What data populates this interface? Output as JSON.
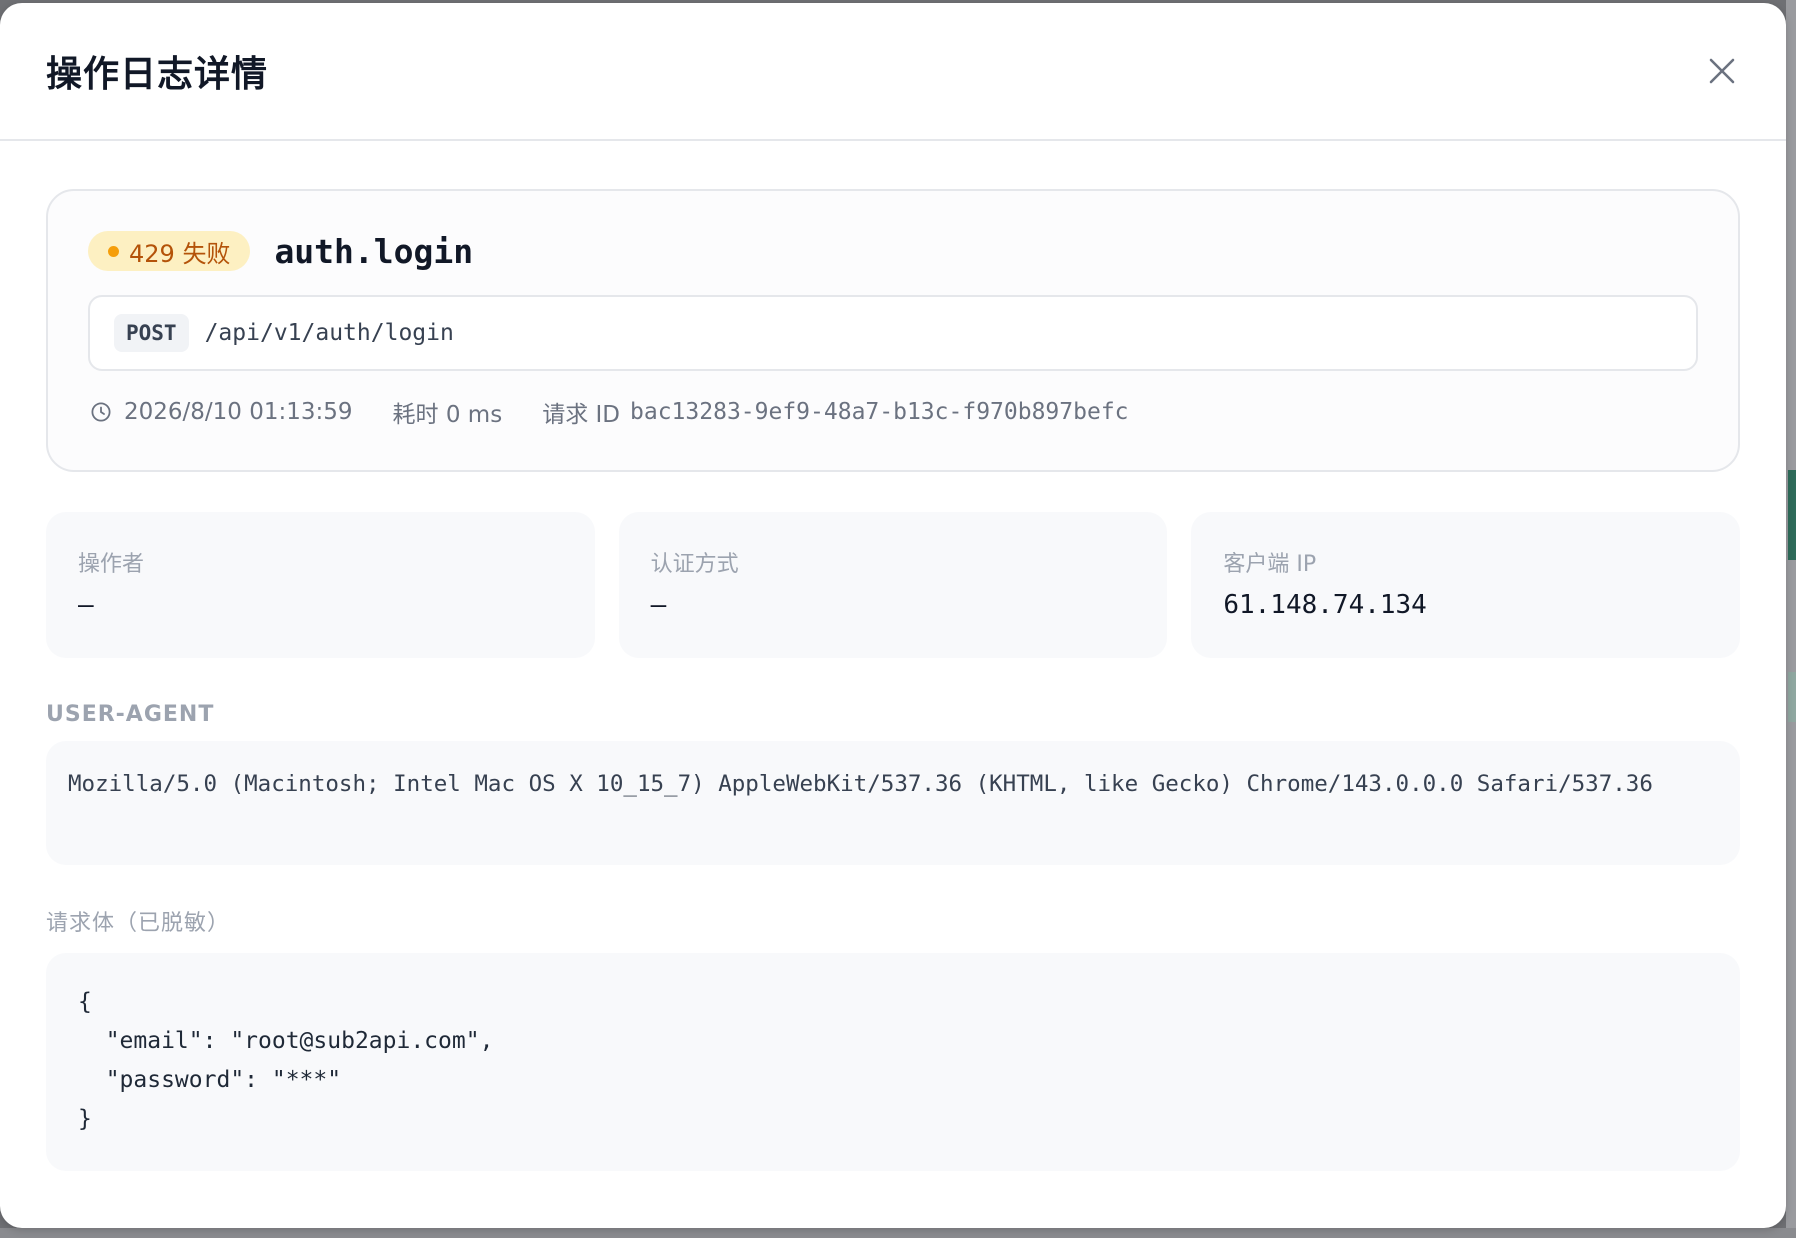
{
  "modal": {
    "title": "操作日志详情",
    "close_icon": "close-icon"
  },
  "summary": {
    "status_badge": "429 失败",
    "status_color": "#f59e0b",
    "action": "auth.login",
    "method": "POST",
    "path": "/api/v1/auth/login",
    "timestamp": "2026/8/10 01:13:59",
    "duration": "耗时 0 ms",
    "request_id_label": "请求 ID",
    "request_id": "bac13283-9ef9-48a7-b13c-f970b897befc"
  },
  "info": [
    {
      "label": "操作者",
      "value": "—"
    },
    {
      "label": "认证方式",
      "value": "—"
    },
    {
      "label": "客户端 IP",
      "value": "61.148.74.134"
    }
  ],
  "user_agent": {
    "label": "USER-AGENT",
    "value": "Mozilla/5.0 (Macintosh; Intel Mac OS X 10_15_7) AppleWebKit/537.36 (KHTML, like Gecko) Chrome/143.0.0.0 Safari/537.36"
  },
  "request_body": {
    "label": "请求体（已脱敏）",
    "code": "{\n  \"email\": \"root@sub2api.com\",\n  \"password\": \"***\"\n}"
  }
}
